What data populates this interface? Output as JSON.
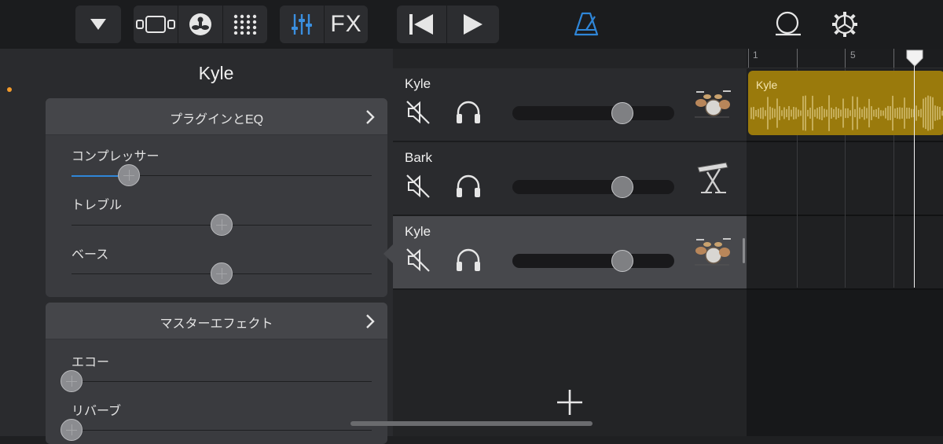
{
  "toolbar": {
    "fx_label": "FX"
  },
  "inspector": {
    "track_title": "Kyle",
    "plugins_card": {
      "header": "プラグインとEQ",
      "sliders": [
        {
          "label": "コンプレッサー",
          "value": 0.19
        },
        {
          "label": "トレブル",
          "value": 0.5
        },
        {
          "label": "ベース",
          "value": 0.5
        }
      ]
    },
    "master_card": {
      "header": "マスターエフェクト",
      "sliders": [
        {
          "label": "エコー",
          "value": 0.0
        },
        {
          "label": "リバーブ",
          "value": 0.0
        }
      ]
    }
  },
  "tracks": [
    {
      "name": "Kyle",
      "instrument": "drum-kit-icon",
      "volume": 0.68,
      "selected": false
    },
    {
      "name": "Bark",
      "instrument": "keyboard-icon",
      "volume": 0.68,
      "selected": false
    },
    {
      "name": "Kyle",
      "instrument": "drum-kit-icon",
      "volume": 0.68,
      "selected": true
    }
  ],
  "timeline": {
    "ruler_marks": [
      "1",
      "5"
    ],
    "regions": [
      {
        "name": "Kyle",
        "color": "#9a7a0c"
      }
    ]
  },
  "colors": {
    "accent": "#2f86d8",
    "metronome": "#2f86d8",
    "region": "#9a7a0c",
    "indicator": "#f39a2a"
  }
}
